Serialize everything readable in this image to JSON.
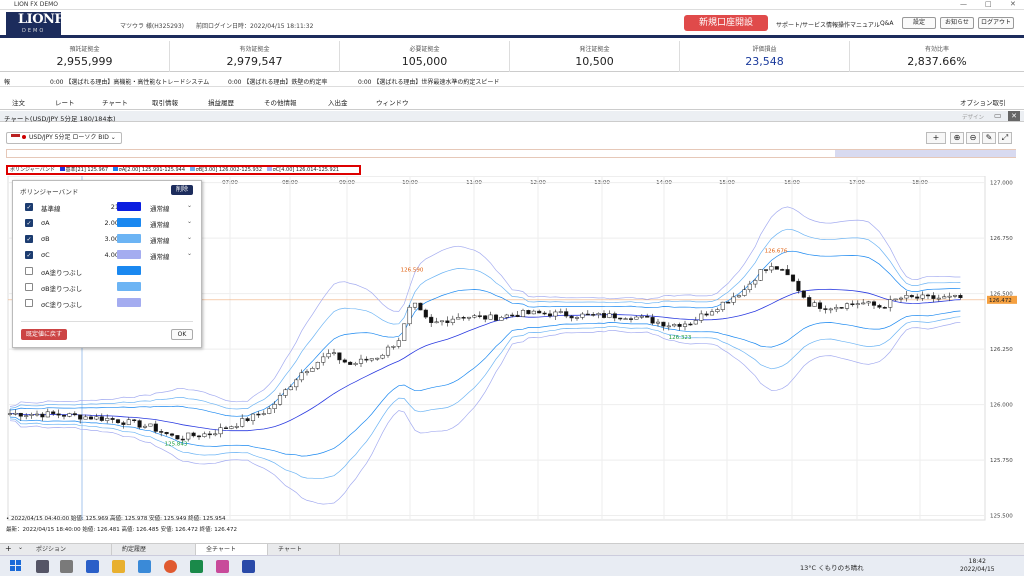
{
  "window": {
    "title": "LION FX DEMO",
    "controls": [
      "—",
      "□",
      "✕"
    ]
  },
  "header": {
    "logo": "LIONFX",
    "logo_sub": "DEMO",
    "user": "マツウラ 様(H325293)",
    "last_login": "前回ログイン日時：2022/04/15 18:11:32",
    "open_account": "新規口座開設",
    "links": [
      "サポート/サービス情報",
      "操作マニュアル",
      "Q&A"
    ],
    "buttons": [
      "設定",
      "お知らせ",
      "ログアウト"
    ]
  },
  "stats": [
    {
      "label": "預託証拠金",
      "value": "2,955,999"
    },
    {
      "label": "有効証拠金",
      "value": "2,979,547"
    },
    {
      "label": "必要証拠金",
      "value": "105,000"
    },
    {
      "label": "発注証拠金",
      "value": "10,500"
    },
    {
      "label": "評価損益",
      "value": "23,548",
      "color": "#1a3a9c"
    },
    {
      "label": "有効比率",
      "value": "2,837.66%"
    }
  ],
  "ticker": {
    "label": "報",
    "items": [
      "0:00 【選ばれる理由】高機能・高性能なトレードシステム",
      "0:00 【選ばれる理由】鉄壁の約定率",
      "0:00 【選ばれる理由】世界最速水準の約定スピード"
    ]
  },
  "menu": {
    "items": [
      "注文",
      "レート",
      "チャート",
      "取引情報",
      "損益履歴",
      "その他情報",
      "入出金",
      "ウィンドウ"
    ],
    "right": "オプション取引"
  },
  "chart_window": {
    "title": "チャート(USD/JPY 5分足 180/184本)",
    "design": "デザイン"
  },
  "toolbar": {
    "symbol": "USD/JPY 5分足 ローソク BID"
  },
  "bb_info": {
    "name": "ボリンジャーバンド",
    "items": [
      {
        "text": "基準[21] 125.967",
        "color": "#1c35d8"
      },
      {
        "text": "σA[2.00] 125.991-125.944",
        "color": "#1a7ff0"
      },
      {
        "text": "σB[3.00] 126.002-125.932",
        "color": "#6fb0f0"
      },
      {
        "text": "σC[4.00] 126.014-125.921",
        "color": "#a8b2f0"
      }
    ]
  },
  "settings_panel": {
    "title": "ボリンジャーバンド",
    "delete": "削除",
    "rows": [
      {
        "checked": true,
        "name": "基準線",
        "value": "21",
        "color": "#0a1ee0",
        "style": "通常線"
      },
      {
        "checked": true,
        "name": "σA",
        "value": "2.00",
        "color": "#1a88f0",
        "style": "通常線"
      },
      {
        "checked": true,
        "name": "σB",
        "value": "3.00",
        "color": "#6cb4f4",
        "style": "通常線"
      },
      {
        "checked": true,
        "name": "σC",
        "value": "4.00",
        "color": "#a4acf0",
        "style": "通常線"
      },
      {
        "checked": false,
        "name": "σA塗りつぶし",
        "value": "",
        "color": "#1a88f0",
        "style": ""
      },
      {
        "checked": false,
        "name": "σB塗りつぶし",
        "value": "",
        "color": "#6cb4f4",
        "style": ""
      },
      {
        "checked": false,
        "name": "σC塗りつぶし",
        "value": "",
        "color": "#a4acf0",
        "style": ""
      }
    ],
    "reset": "既定値に戻す",
    "ok": "OK"
  },
  "ohlc_line1": "• 2022/04/15 04:40:00 始値: 125.969 高値: 125.978 安値: 125.949 終値: 125.954",
  "ohlc_line2": "最新：2022/04/15 18:40:00 始値: 126.481 高値: 126.485 安値: 126.472 終値: 126.472",
  "chart_data": {
    "type": "candlestick",
    "x_ticks": [
      "07:00",
      "08:00",
      "09:00",
      "10:00",
      "11:00",
      "12:00",
      "13:00",
      "14:00",
      "15:00",
      "16:00",
      "17:00",
      "18:00"
    ],
    "y_ticks": [
      "127.000",
      "126.750",
      "126.500",
      "126.250",
      "126.000",
      "125.750",
      "125.500"
    ],
    "ylim": [
      125.48,
      127.03
    ],
    "current_price": "126.472",
    "annotations": [
      {
        "text": "126.590",
        "color": "#e06010"
      },
      {
        "text": "125.843",
        "color": "#1a9a3a"
      },
      {
        "text": "126.323",
        "color": "#1a9a3a"
      },
      {
        "text": "126.676",
        "color": "#e06010"
      }
    ],
    "series": [
      {
        "name": "基準線",
        "color": "#2a3ae0"
      },
      {
        "name": "σA",
        "color": "#1a88f0"
      },
      {
        "name": "σB",
        "color": "#6cb4f4"
      },
      {
        "name": "σC",
        "color": "#a4acf0"
      }
    ]
  },
  "bottom_tabs": [
    "ポジション",
    "約定履歴",
    "全チャート",
    "チャート"
  ],
  "taskbar": {
    "weather": "13°C くもりのち晴れ",
    "time": "18:42",
    "date": "2022/04/15"
  }
}
